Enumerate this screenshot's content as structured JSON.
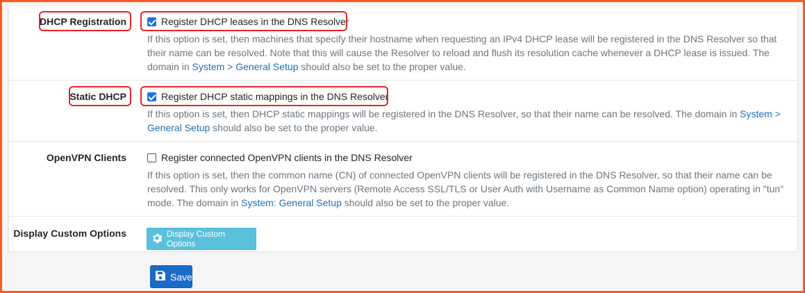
{
  "colors": {
    "frame_border": "#ff5722",
    "highlight": "#e3252b",
    "link": "#1e6fb5",
    "checkbox_accent": "#1a73e8",
    "info_button": "#5bc0de",
    "primary_button": "#1a6bc7"
  },
  "rows": {
    "dhcp_registration": {
      "label": "DHCP Registration",
      "checkbox_label": "Register DHCP leases in the DNS Resolver",
      "checked": true,
      "help_text": "If this option is set, then machines that specify their hostname when requesting an IPv4 DHCP lease will be registered in the DNS Resolver so that their name can be resolved. Note that this will cause the Resolver to reload and flush its resolution cache whenever a DHCP lease is issued. The domain in ",
      "help_link": "System > General Setup",
      "help_suffix": " should also be set to the proper value."
    },
    "static_dhcp": {
      "label": "Static DHCP",
      "checkbox_label": "Register DHCP static mappings in the DNS Resolver",
      "checked": true,
      "help_text": "If this option is set, then DHCP static mappings will be registered in the DNS Resolver, so that their name can be resolved. The domain in ",
      "help_link": "System > General Setup",
      "help_suffix": " should also be set to the proper value."
    },
    "openvpn_clients": {
      "label": "OpenVPN Clients",
      "checkbox_label": "Register connected OpenVPN clients in the DNS Resolver",
      "checked": false,
      "help_text": "If this option is set, then the common name (CN) of connected OpenVPN clients will be registered in the DNS Resolver, so that their name can be resolved. This only works for OpenVPN servers (Remote Access SSL/TLS or User Auth with Username as Common Name option) operating in \"tun\" mode. The domain in ",
      "help_link": "System: General Setup",
      "help_suffix": " should also be set to the proper value."
    },
    "custom_options": {
      "label": "Display Custom Options",
      "button_label": "Display Custom Options",
      "button_icon": "gear-icon"
    }
  },
  "save": {
    "label": "Save",
    "icon": "floppy-disk-icon"
  }
}
